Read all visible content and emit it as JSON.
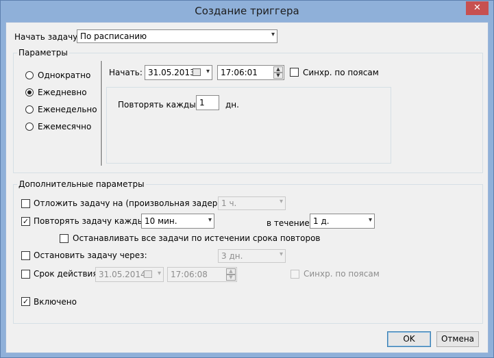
{
  "window": {
    "title": "Создание триггера",
    "close_glyph": "✕"
  },
  "start_task": {
    "label": "Начать задачу:",
    "value": "По расписанию"
  },
  "params": {
    "legend": "Параметры",
    "schedule_options": [
      {
        "label": "Однократно",
        "selected": false
      },
      {
        "label": "Ежедневно",
        "selected": true
      },
      {
        "label": "Еженедельно",
        "selected": false
      },
      {
        "label": "Ежемесячно",
        "selected": false
      }
    ],
    "start_label": "Начать:",
    "start_date": "31.05.2013",
    "start_time": "17:06:01",
    "sync_label": "Синхр. по поясам",
    "repeat_every_label": "Повторять каждые:",
    "repeat_every_value": "1",
    "repeat_every_unit": "дн."
  },
  "advanced": {
    "legend": "Дополнительные параметры",
    "delay_label": "Отложить задачу на (произвольная задержка):",
    "delay_value": "1 ч.",
    "repeat_label": "Повторять задачу каждые:",
    "repeat_value": "10 мин.",
    "duration_label": "в течение:",
    "duration_value": "1 д.",
    "stop_all_label": "Останавливать все задачи по истечении срока повторов",
    "stop_after_label": "Остановить задачу через:",
    "stop_after_value": "3 дн.",
    "expire_label": "Срок действия:",
    "expire_date": "31.05.2014",
    "expire_time": "17:06:08",
    "expire_sync_label": "Синхр. по поясам",
    "enabled_label": "Включено"
  },
  "buttons": {
    "ok": "OK",
    "cancel": "Отмена"
  },
  "icons": {
    "check": "✓",
    "arrow": "▾",
    "up": "▲",
    "down": "▼"
  }
}
